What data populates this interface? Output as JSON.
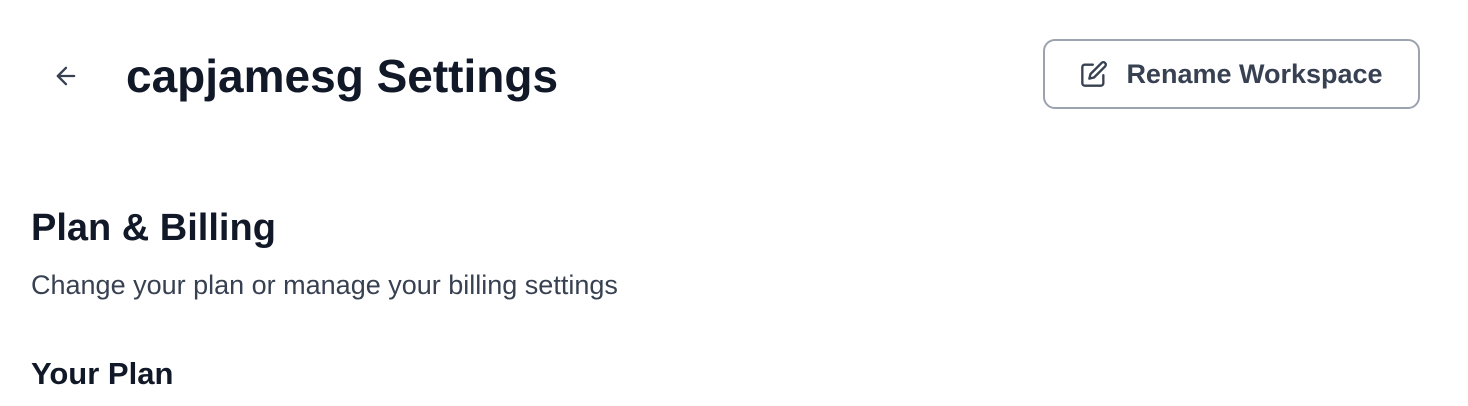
{
  "header": {
    "title": "capjamesg Settings",
    "back_icon": "arrow-left-icon",
    "rename_button": {
      "label": "Rename Workspace",
      "icon": "edit-icon"
    }
  },
  "billing": {
    "title": "Plan & Billing",
    "subtitle": "Change your plan or manage your billing settings",
    "your_plan_label": "Your Plan"
  },
  "colors": {
    "text_primary": "#111827",
    "text_secondary": "#374151",
    "border": "#9ca3af",
    "background": "#ffffff"
  }
}
